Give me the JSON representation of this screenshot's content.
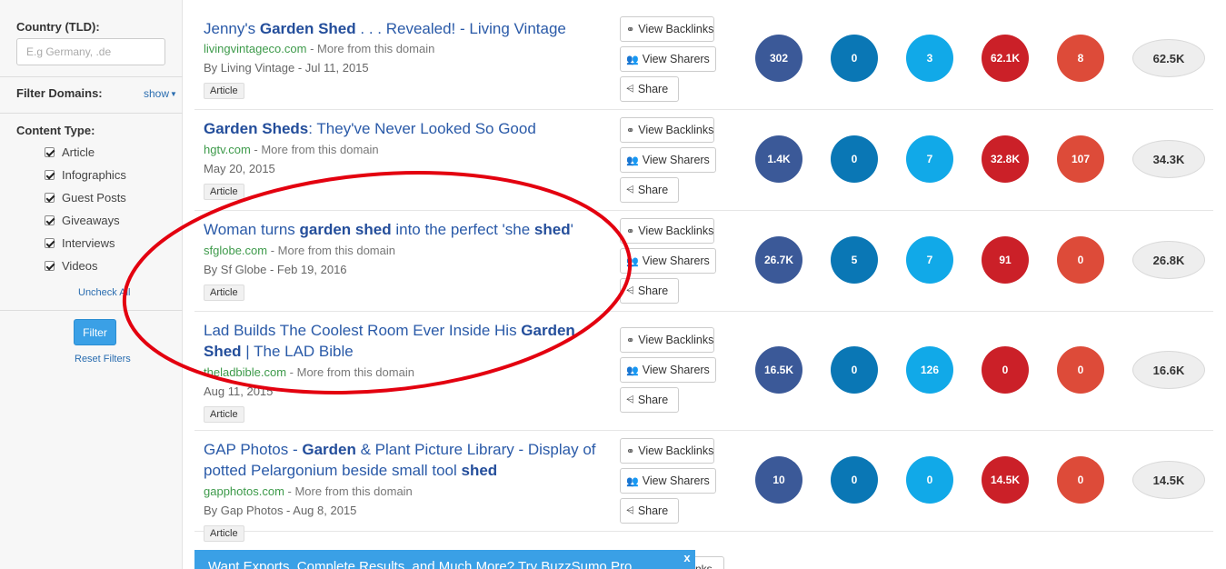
{
  "sidebar": {
    "country_label": "Country (TLD):",
    "country_placeholder": "E.g Germany, .de",
    "filter_domains_label": "Filter Domains:",
    "show_label": "show",
    "content_type_label": "Content Type:",
    "content_types": [
      "Article",
      "Infographics",
      "Guest Posts",
      "Giveaways",
      "Interviews",
      "Videos"
    ],
    "uncheck_all": "Uncheck All",
    "filter_button": "Filter",
    "reset_filters": "Reset Filters"
  },
  "actions": {
    "backlinks": "View Backlinks",
    "sharers": "View Sharers",
    "share": "Share"
  },
  "more_from_domain": "More from this domain",
  "results": [
    {
      "title_parts": [
        [
          "Jenny's ",
          false
        ],
        [
          "Garden Shed",
          true
        ],
        [
          " . . . Revealed! - Living Vintage",
          false
        ]
      ],
      "domain": "livingvintageco.com",
      "meta": "By Living Vintage - Jul 11, 2015",
      "type": "Article",
      "counts": [
        "302",
        "0",
        "3",
        "62.1K",
        "8"
      ],
      "total": "62.5K"
    },
    {
      "title_parts": [
        [
          "Garden Sheds",
          true
        ],
        [
          ": They've Never Looked So Good",
          false
        ]
      ],
      "domain": "hgtv.com",
      "meta": "May 20, 2015",
      "type": "Article",
      "counts": [
        "1.4K",
        "0",
        "7",
        "32.8K",
        "107"
      ],
      "total": "34.3K"
    },
    {
      "title_parts": [
        [
          "Woman turns ",
          false
        ],
        [
          "garden shed",
          true
        ],
        [
          " into the perfect 'she ",
          false
        ],
        [
          "shed",
          true
        ],
        [
          "'",
          false
        ]
      ],
      "domain": "sfglobe.com",
      "meta": "By Sf Globe - Feb 19, 2016",
      "type": "Article",
      "counts": [
        "26.7K",
        "5",
        "7",
        "91",
        "0"
      ],
      "total": "26.8K"
    },
    {
      "title_parts": [
        [
          "Lad Builds The Coolest Room Ever Inside His ",
          false
        ],
        [
          "Garden Shed",
          true
        ],
        [
          " | The LAD Bible",
          false
        ]
      ],
      "domain": "theladbible.com",
      "meta": "Aug 11, 2015",
      "type": "Article",
      "counts": [
        "16.5K",
        "0",
        "126",
        "0",
        "0"
      ],
      "total": "16.6K"
    },
    {
      "title_parts": [
        [
          "GAP Photos - ",
          false
        ],
        [
          "Garden",
          true
        ],
        [
          " & Plant Picture Library - Display of potted Pelargonium beside small tool ",
          false
        ],
        [
          "shed",
          true
        ]
      ],
      "domain": "gapphotos.com",
      "meta": "By Gap Photos - Aug 8, 2015",
      "type": "Article",
      "counts": [
        "10",
        "0",
        "0",
        "14.5K",
        "0"
      ],
      "total": "14.5K"
    }
  ],
  "banner": {
    "text": "Want Exports, Complete Results, and Much More? Try BuzzSumo Pro",
    "close": "x",
    "peek": "nks"
  },
  "colors": {
    "facebook": "#3b5998",
    "linkedin": "#0a77b5",
    "twitter": "#11a9e8",
    "pinterest": "#cb2028",
    "googleplus": "#dd4b39",
    "annotation": "#e3000f",
    "link_blue": "#2a5aa8",
    "domain_green": "#3d9a4a"
  },
  "icons": {
    "backlinks": "link-icon",
    "sharers": "users-icon",
    "share": "share-icon"
  }
}
